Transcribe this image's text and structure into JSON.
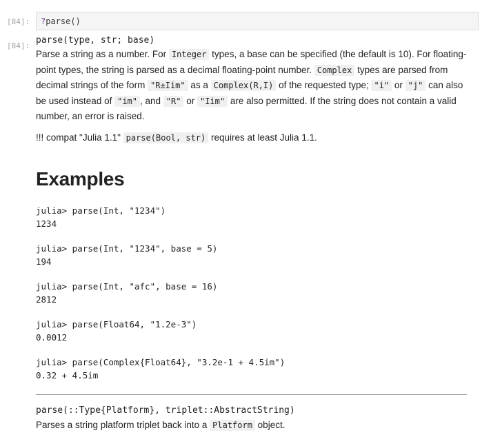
{
  "input_cell": {
    "prompt": "[84]:",
    "code_prefix": "?",
    "code": "parse()"
  },
  "output_cell": {
    "prompt": "[84]:",
    "signature": "parse(type, str; base)",
    "description": {
      "p1": "Parse a string as a number. For ",
      "c1": "Integer",
      "p2": " types, a base can be specified (the default is 10). For floating-point types, the string is parsed as a decimal floating-point number. ",
      "c2": "Complex",
      "p3": " types are parsed from decimal strings of the form ",
      "c3": "\"R±Iim\"",
      "p4": " as a ",
      "c4": "Complex(R,I)",
      "p5": " of the requested type; ",
      "c5": "\"i\"",
      "p6": " or ",
      "c6": "\"j\"",
      "p7": " can also be used instead of ",
      "c7": "\"im\"",
      "p8": ", and ",
      "c8": "\"R\"",
      "p9": " or ",
      "c9": "\"Iim\"",
      "p10": " are also permitted. If the string does not contain a valid number, an error is raised."
    },
    "compat": {
      "prefix": "!!! compat \"Julia 1.1\" ",
      "code": "parse(Bool, str)",
      "suffix": " requires at least Julia 1.1."
    },
    "examples_heading": "Examples",
    "examples": [
      {
        "input": "julia> parse(Int, \"1234\")",
        "output": "1234"
      },
      {
        "input": "julia> parse(Int, \"1234\", base = 5)",
        "output": "194"
      },
      {
        "input": "julia> parse(Int, \"afc\", base = 16)",
        "output": "2812"
      },
      {
        "input": "julia> parse(Float64, \"1.2e-3\")",
        "output": "0.0012"
      },
      {
        "input": "julia> parse(Complex{Float64}, \"3.2e-1 + 4.5im\")",
        "output": "0.32 + 4.5im"
      }
    ],
    "signature2": "parse(::Type{Platform}, triplet::AbstractString)",
    "description2": {
      "p1": "Parses a string platform triplet back into a ",
      "c1": "Platform",
      "p2": " object."
    }
  }
}
